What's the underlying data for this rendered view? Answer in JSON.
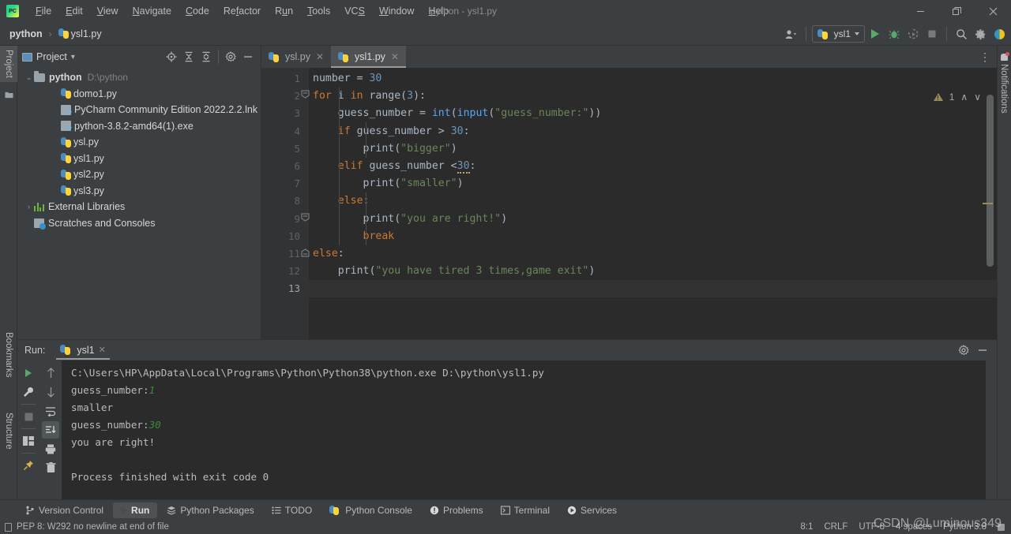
{
  "window": {
    "title": "python - ysl1.py",
    "controls": {
      "minimize": "—",
      "restore": "❐",
      "close": "✕"
    }
  },
  "menubar": {
    "items": [
      {
        "label": "File"
      },
      {
        "label": "Edit"
      },
      {
        "label": "View"
      },
      {
        "label": "Navigate"
      },
      {
        "label": "Code"
      },
      {
        "label": "Refactor"
      },
      {
        "label": "Run"
      },
      {
        "label": "Tools"
      },
      {
        "label": "VCS"
      },
      {
        "label": "Window"
      },
      {
        "label": "Help"
      }
    ]
  },
  "breadcrumb": {
    "project": "python",
    "separator": "›",
    "file": "ysl1.py"
  },
  "toolbar": {
    "account_icon": "user-icon",
    "run_config": "ysl1",
    "run_icon": "run-icon",
    "debug_icon": "debug-icon",
    "coverage_icon": "coverage-icon",
    "stop_icon": "stop-icon",
    "search_icon": "🔍",
    "settings_icon": "⚙",
    "updates_icon": "updates-icon"
  },
  "left_rail": {
    "tabs": [
      {
        "label": "Project",
        "selected": true
      },
      {
        "label": "Bookmarks",
        "selected": false
      },
      {
        "label": "Structure",
        "selected": false
      }
    ]
  },
  "right_rail": {
    "notifications_label": "Notifications"
  },
  "project_panel": {
    "title": "Project",
    "dropdown_caret": "▾",
    "header_icons": [
      {
        "name": "locate-icon",
        "glyph": "⊕"
      },
      {
        "name": "expand-all-icon",
        "glyph": "⩝"
      },
      {
        "name": "collapse-all-icon",
        "glyph": "⩞"
      },
      {
        "name": "settings-gear-icon",
        "glyph": "⚙"
      },
      {
        "name": "hide-panel-icon",
        "glyph": "—"
      }
    ],
    "tree": [
      {
        "label": "python",
        "path": "D:\\python",
        "type": "folder",
        "indent": 0,
        "twist": "⌄",
        "bold": true
      },
      {
        "label": "domo1.py",
        "type": "python",
        "indent": 1,
        "twist": ""
      },
      {
        "label": "PyCharm Community Edition 2022.2.2.lnk",
        "type": "file",
        "indent": 1,
        "twist": ""
      },
      {
        "label": "python-3.8.2-amd64(1).exe",
        "type": "file",
        "indent": 1,
        "twist": ""
      },
      {
        "label": "ysl.py",
        "type": "python",
        "indent": 1,
        "twist": ""
      },
      {
        "label": "ysl1.py",
        "type": "python",
        "indent": 1,
        "twist": ""
      },
      {
        "label": "ysl2.py",
        "type": "python",
        "indent": 1,
        "twist": ""
      },
      {
        "label": "ysl3.py",
        "type": "python",
        "indent": 1,
        "twist": ""
      },
      {
        "label": "External Libraries",
        "type": "library",
        "indent": 0,
        "twist": "›"
      },
      {
        "label": "Scratches and Consoles",
        "type": "scratch",
        "indent": 0,
        "twist": ""
      }
    ]
  },
  "editor": {
    "tabs": [
      {
        "label": "ysl.py",
        "active": false,
        "close": "✕"
      },
      {
        "label": "ysl1.py",
        "active": true,
        "close": "✕"
      }
    ],
    "more_icon": "⋮",
    "inspection": {
      "warning_count": "1",
      "prev": "∧",
      "next": "∨"
    },
    "line_numbers": [
      "1",
      "2",
      "3",
      "4",
      "5",
      "6",
      "7",
      "8",
      "9",
      "10",
      "11",
      "12",
      "13"
    ],
    "current_line": 13,
    "code_lines": [
      [
        {
          "t": "number ",
          "c": "def"
        },
        {
          "t": "= ",
          "c": "def"
        },
        {
          "t": "30",
          "c": "num"
        }
      ],
      [
        {
          "t": "for",
          "c": "kw"
        },
        {
          "t": " i ",
          "c": "def"
        },
        {
          "t": "in",
          "c": "kw"
        },
        {
          "t": " range(",
          "c": "def"
        },
        {
          "t": "3",
          "c": "num"
        },
        {
          "t": "):",
          "c": "def"
        }
      ],
      [
        {
          "t": "    guess_number = ",
          "c": "def"
        },
        {
          "t": "int",
          "c": "fn"
        },
        {
          "t": "(",
          "c": "def"
        },
        {
          "t": "input",
          "c": "fn"
        },
        {
          "t": "(",
          "c": "def"
        },
        {
          "t": "\"guess_number:\"",
          "c": "str"
        },
        {
          "t": "))",
          "c": "def"
        }
      ],
      [
        {
          "t": "    ",
          "c": "def"
        },
        {
          "t": "if",
          "c": "kw"
        },
        {
          "t": " guess_number > ",
          "c": "def"
        },
        {
          "t": "30",
          "c": "num"
        },
        {
          "t": ":",
          "c": "def"
        }
      ],
      [
        {
          "t": "        print(",
          "c": "def"
        },
        {
          "t": "\"bigger\"",
          "c": "str"
        },
        {
          "t": ")",
          "c": "def"
        }
      ],
      [
        {
          "t": "    ",
          "c": "def"
        },
        {
          "t": "elif",
          "c": "kw"
        },
        {
          "t": " guess_number <",
          "c": "def"
        },
        {
          "t": "30",
          "c": "num-warn"
        },
        {
          "t": ":",
          "c": "def"
        }
      ],
      [
        {
          "t": "        print(",
          "c": "def"
        },
        {
          "t": "\"smaller\"",
          "c": "str"
        },
        {
          "t": ")",
          "c": "def"
        }
      ],
      [
        {
          "t": "    ",
          "c": "def"
        },
        {
          "t": "else",
          "c": "kw"
        },
        {
          "t": ":",
          "c": "def"
        }
      ],
      [
        {
          "t": "        print(",
          "c": "def"
        },
        {
          "t": "\"you are right!\"",
          "c": "str"
        },
        {
          "t": ")",
          "c": "def"
        }
      ],
      [
        {
          "t": "        ",
          "c": "def"
        },
        {
          "t": "break",
          "c": "kw"
        }
      ],
      [
        {
          "t": "else",
          "c": "kw"
        },
        {
          "t": ":",
          "c": "def"
        }
      ],
      [
        {
          "t": "    print(",
          "c": "def"
        },
        {
          "t": "\"you have tired 3 times,game exit\"",
          "c": "str"
        },
        {
          "t": ")",
          "c": "def"
        }
      ],
      [
        {
          "t": "",
          "c": "def"
        }
      ]
    ]
  },
  "run_panel": {
    "label": "Run:",
    "tab": "ysl1",
    "tab_close": "✕",
    "settings_icon": "⚙",
    "hide_icon": "—",
    "left_tools": [
      {
        "name": "rerun-icon",
        "glyph": "▶"
      },
      {
        "name": "run-settings-icon",
        "glyph": "🔧"
      },
      {
        "name": "stop-icon",
        "glyph": "■"
      },
      {
        "name": "layout-icon",
        "glyph": "▤"
      },
      {
        "name": "pin-icon",
        "glyph": "📌"
      }
    ],
    "right_tools": [
      {
        "name": "up-arrow-icon",
        "glyph": "↑"
      },
      {
        "name": "down-arrow-icon",
        "glyph": "↓"
      },
      {
        "name": "soft-wrap-icon",
        "glyph": "↵"
      },
      {
        "name": "scroll-to-end-icon",
        "glyph": "↧"
      },
      {
        "name": "print-icon",
        "glyph": "🖨"
      },
      {
        "name": "clear-all-icon",
        "glyph": "🗑"
      }
    ],
    "console": [
      {
        "parts": [
          {
            "t": "C:\\Users\\HP\\AppData\\Local\\Programs\\Python\\Python38\\python.exe D:\\python\\ysl1.py",
            "c": "out"
          }
        ]
      },
      {
        "parts": [
          {
            "t": "guess_number:",
            "c": "out"
          },
          {
            "t": "1",
            "c": "in"
          }
        ]
      },
      {
        "parts": [
          {
            "t": "smaller",
            "c": "out"
          }
        ]
      },
      {
        "parts": [
          {
            "t": "guess_number:",
            "c": "out"
          },
          {
            "t": "30",
            "c": "in"
          }
        ]
      },
      {
        "parts": [
          {
            "t": "you are right!",
            "c": "out"
          }
        ]
      },
      {
        "parts": [
          {
            "t": "",
            "c": "out"
          }
        ]
      },
      {
        "parts": [
          {
            "t": "Process finished with exit code 0",
            "c": "out"
          }
        ]
      }
    ]
  },
  "bottom_tabs": [
    {
      "label": "Version Control",
      "icon": "branch-icon",
      "glyph": "⑂",
      "selected": false
    },
    {
      "label": "Run",
      "icon": "run-icon",
      "glyph": "▶",
      "selected": true
    },
    {
      "label": "Python Packages",
      "icon": "packages-icon",
      "glyph": "≣",
      "selected": false
    },
    {
      "label": "TODO",
      "icon": "todo-icon",
      "glyph": "≡",
      "selected": false
    },
    {
      "label": "Python Console",
      "icon": "python-console-icon",
      "glyph": "⎇",
      "selected": false
    },
    {
      "label": "Problems",
      "icon": "problems-icon",
      "glyph": "❗",
      "selected": false
    },
    {
      "label": "Terminal",
      "icon": "terminal-icon",
      "glyph": "▣",
      "selected": false
    },
    {
      "label": "Services",
      "icon": "services-icon",
      "glyph": "▷",
      "selected": false
    }
  ],
  "statusbar": {
    "message": "PEP 8: W292 no newline at end of file",
    "caret": "8:1",
    "line_separator": "CRLF",
    "encoding": "UTF-8",
    "indent": "4 spaces",
    "interpreter": "Python 3.8",
    "lock_icon": "read-only-icon"
  },
  "watermark": "CSDN @Luminous349",
  "colors": {
    "bg_chrome": "#3c3f41",
    "bg_editor": "#2b2b2b",
    "gutter": "#313335",
    "keyword": "#cc7832",
    "number": "#6897bb",
    "string": "#6a8759",
    "function": "#56a8f5",
    "default_text": "#a9b7c6",
    "console_input": "#3b8b3b",
    "accent_run": "#59a869"
  }
}
